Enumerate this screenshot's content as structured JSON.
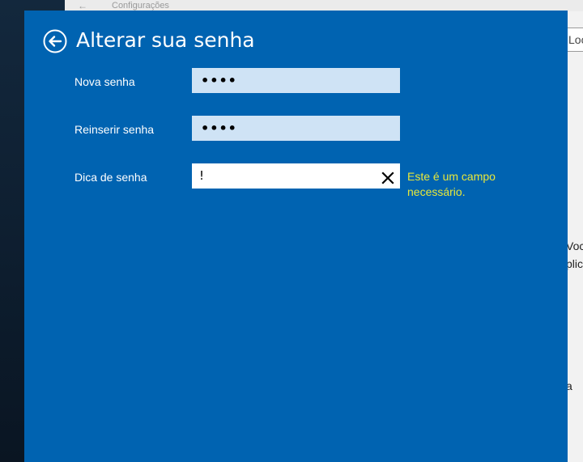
{
  "background_window": {
    "title": "Configurações",
    "search_text": "Loc",
    "text_fragments": [
      "Voc",
      "plic",
      "a"
    ]
  },
  "dialog": {
    "title": "Alterar sua senha",
    "back_icon": "back-arrow-circle-icon",
    "fields": [
      {
        "label": "Nova senha",
        "value": "••••"
      },
      {
        "label": "Reinserir senha",
        "value": "••••"
      },
      {
        "label": "Dica de senha",
        "value": "!"
      }
    ],
    "clear_icon": "close-icon",
    "error_message": "Este é um campo necessário."
  },
  "colors": {
    "dialog_bg": "#0063b1",
    "filled_field_bg": "#cfe3f5",
    "error_text": "#e8e83a"
  }
}
